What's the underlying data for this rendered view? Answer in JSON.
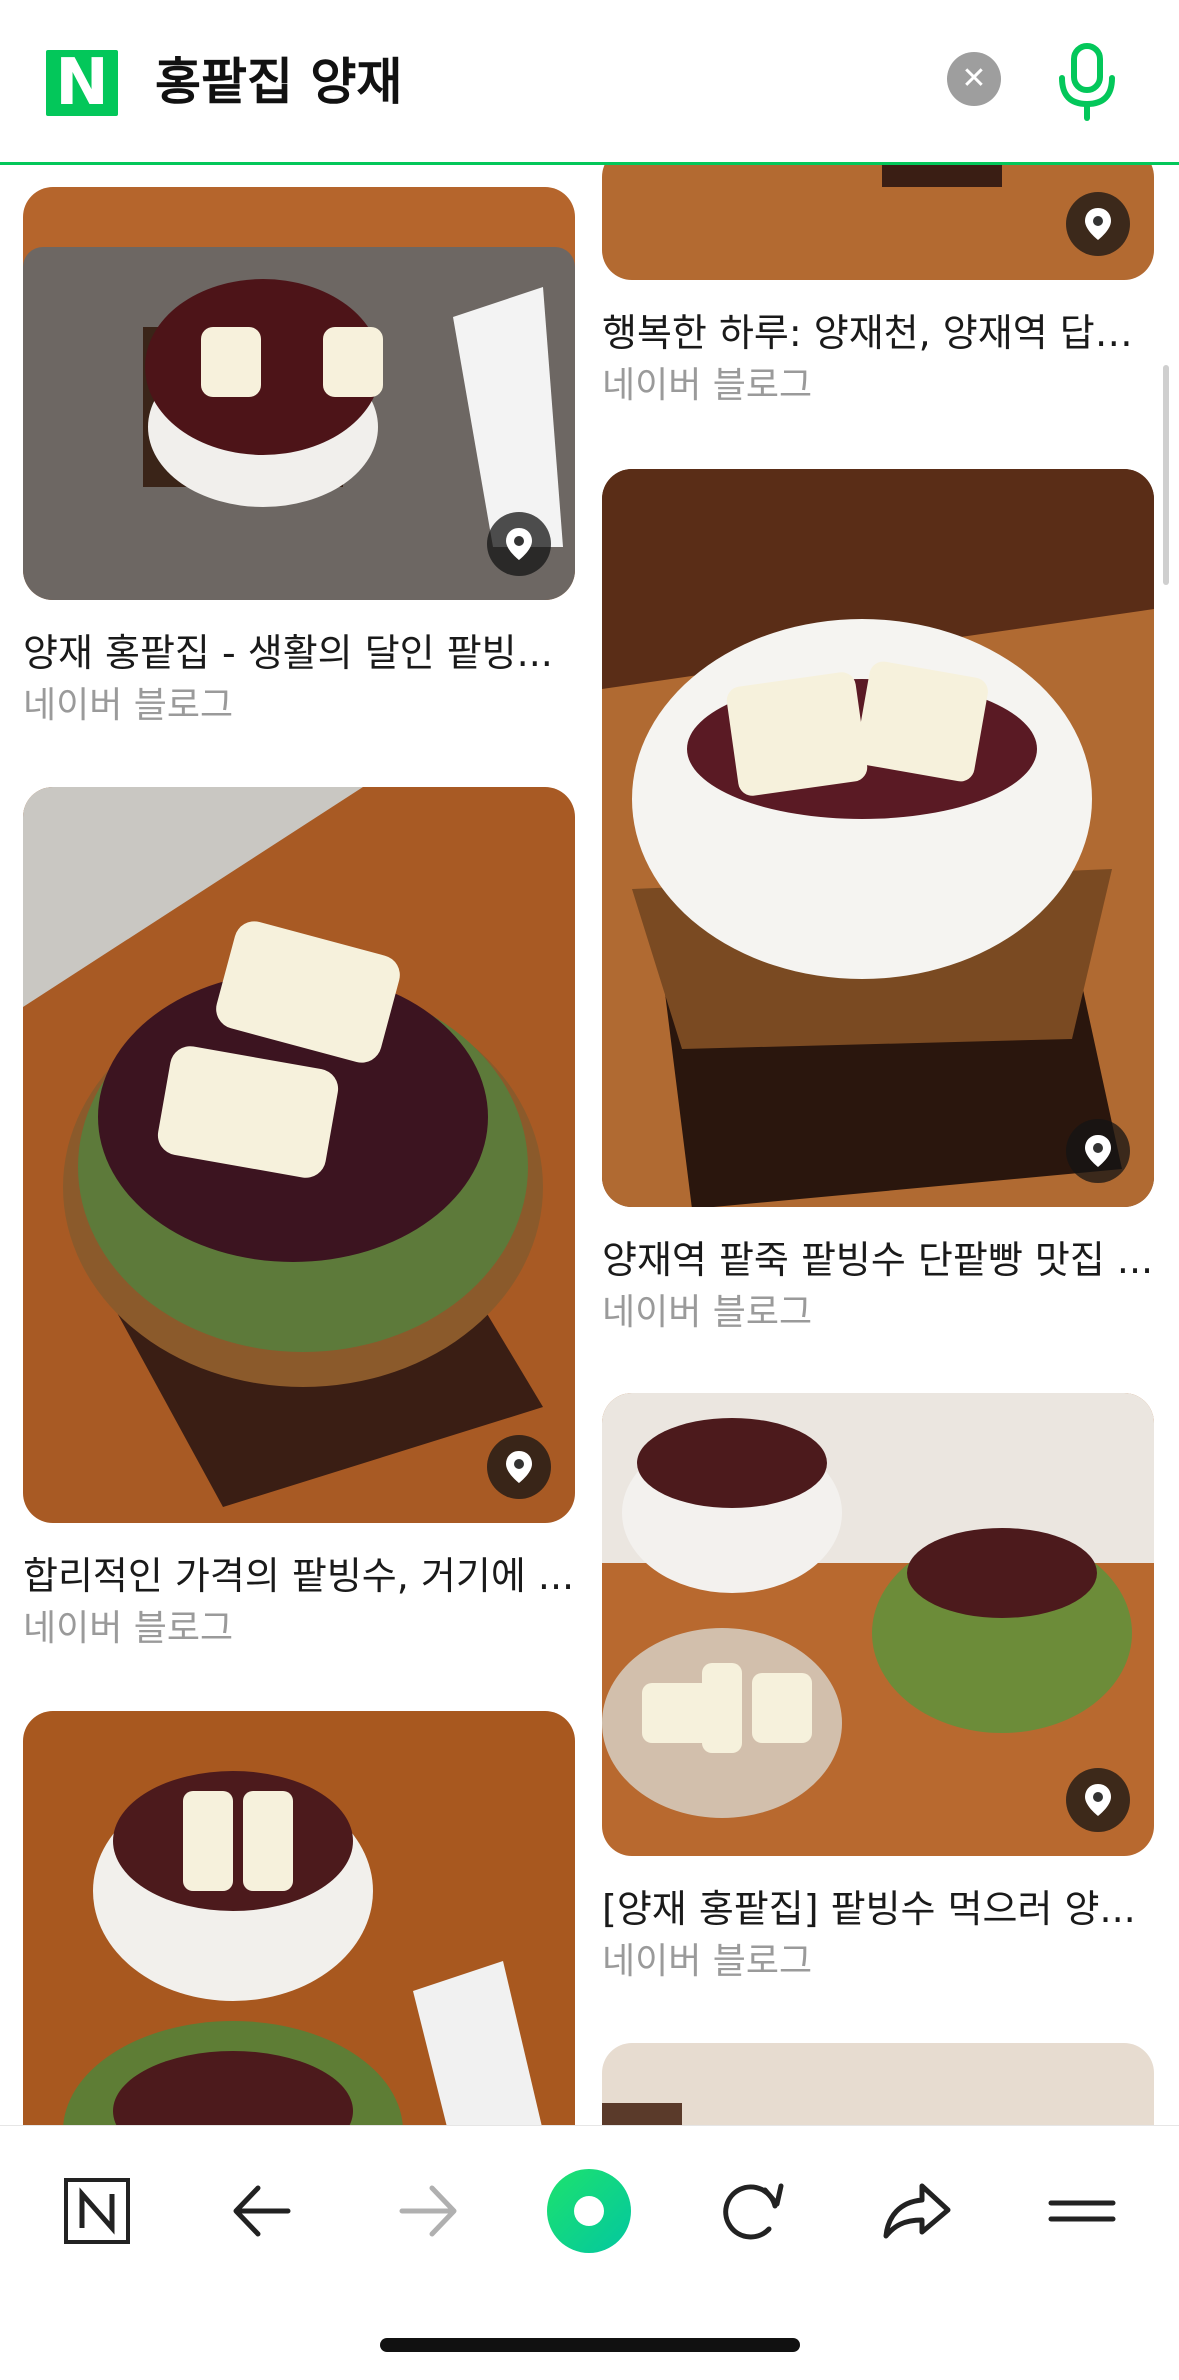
{
  "header": {
    "logo": "N",
    "query": "홍팥집 양재"
  },
  "results": {
    "left": [
      {
        "caption": "양재 홍팥집 - 생활의 달인 팥빙...",
        "source": "네이버 블로그"
      },
      {
        "caption": "합리적인 가격의 팥빙수, 거기에 ...",
        "source": "네이버 블로그"
      },
      {
        "caption": "",
        "source": ""
      }
    ],
    "right": [
      {
        "caption": "행복한 하루: 양재천, 양재역 답다...",
        "source": "네이버 블로그"
      },
      {
        "caption": "양재역 팥죽 팥빙수 단팥빵 맛집 ...",
        "source": "네이버 블로그"
      },
      {
        "caption": "[양재 홍팥집] 팥빙수 먹으러 양...",
        "source": "네이버 블로그"
      }
    ]
  },
  "bottom_nav": {
    "items": [
      "naver-home",
      "back",
      "forward",
      "green-dot",
      "reload",
      "share",
      "menu"
    ]
  },
  "colors": {
    "brand_green": "#03c75a",
    "pin_bg": "#1e1e1e"
  }
}
